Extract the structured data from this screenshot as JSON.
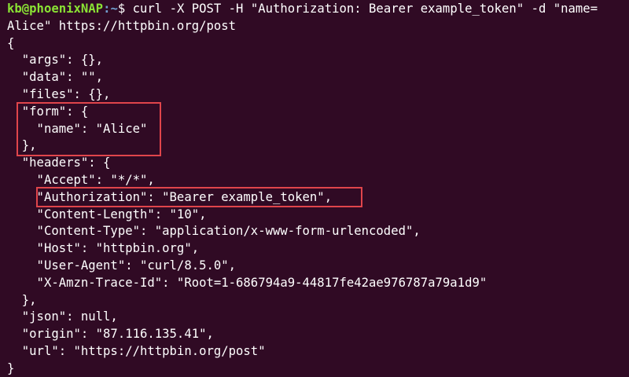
{
  "prompt": {
    "user_host": "kb@phoenixNAP",
    "path": ":~",
    "symbol": "$ ",
    "command_part1": "curl -X POST -H \"Authorization: Bearer example_token\" -d \"name=",
    "command_part2": "Alice\" https://httpbin.org/post"
  },
  "output_lines": [
    "{",
    "  \"args\": {},",
    "  \"data\": \"\",",
    "  \"files\": {},",
    "  \"form\": {",
    "    \"name\": \"Alice\"",
    "  },",
    "  \"headers\": {",
    "    \"Accept\": \"*/*\",",
    "    \"Authorization\": \"Bearer example_token\",",
    "    \"Content-Length\": \"10\",",
    "    \"Content-Type\": \"application/x-www-form-urlencoded\",",
    "    \"Host\": \"httpbin.org\",",
    "    \"User-Agent\": \"curl/8.5.0\",",
    "    \"X-Amzn-Trace-Id\": \"Root=1-686794a9-44817fe42ae976787a79a1d9\"",
    "  },",
    "  \"json\": null,",
    "  \"origin\": \"87.116.135.41\",",
    "  \"url\": \"https://httpbin.org/post\"",
    "}"
  ],
  "colors": {
    "background": "#300a24",
    "text": "#ffffff",
    "prompt_user": "#8ae234",
    "prompt_path": "#729fcf",
    "highlight": "#e0454b"
  }
}
